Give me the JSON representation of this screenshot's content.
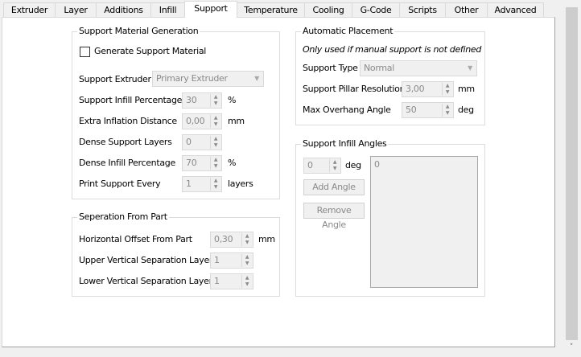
{
  "tabs": [
    {
      "label": "Extruder"
    },
    {
      "label": "Layer"
    },
    {
      "label": "Additions"
    },
    {
      "label": "Infill"
    },
    {
      "label": "Support"
    },
    {
      "label": "Temperature"
    },
    {
      "label": "Cooling"
    },
    {
      "label": "G-Code"
    },
    {
      "label": "Scripts"
    },
    {
      "label": "Other"
    },
    {
      "label": "Advanced"
    }
  ],
  "active_tab": "Support",
  "generation": {
    "title": "Support Material Generation",
    "generate_label": "Generate Support Material",
    "generate_checked": false,
    "extruder_label": "Support Extruder",
    "extruder_value": "Primary Extruder",
    "infill_pct_label": "Support Infill Percentage",
    "infill_pct_value": "30",
    "infill_pct_unit": "%",
    "inflation_label": "Extra Inflation Distance",
    "inflation_value": "0,00",
    "inflation_unit": "mm",
    "dense_layers_label": "Dense Support Layers",
    "dense_layers_value": "0",
    "dense_infill_label": "Dense Infill Percentage",
    "dense_infill_value": "70",
    "dense_infill_unit": "%",
    "every_label": "Print Support Every",
    "every_value": "1",
    "every_unit": "layers"
  },
  "separation": {
    "title": "Seperation From Part",
    "horiz_label": "Horizontal Offset From Part",
    "horiz_value": "0,30",
    "horiz_unit": "mm",
    "upper_label": "Upper Vertical Separation Layers",
    "upper_value": "1",
    "lower_label": "Lower Vertical Separation Layers",
    "lower_value": "1"
  },
  "placement": {
    "title": "Automatic Placement",
    "note": "Only used if manual support is not defined",
    "type_label": "Support Type",
    "type_value": "Normal",
    "pillar_label": "Support Pillar Resolution",
    "pillar_value": "3,00",
    "pillar_unit": "mm",
    "overhang_label": "Max Overhang Angle",
    "overhang_value": "50",
    "overhang_unit": "deg"
  },
  "angles": {
    "title": "Support Infill Angles",
    "angle_value": "0",
    "angle_unit": "deg",
    "add_label": "Add Angle",
    "remove_label": "Remove Angle",
    "list": [
      "0"
    ]
  }
}
